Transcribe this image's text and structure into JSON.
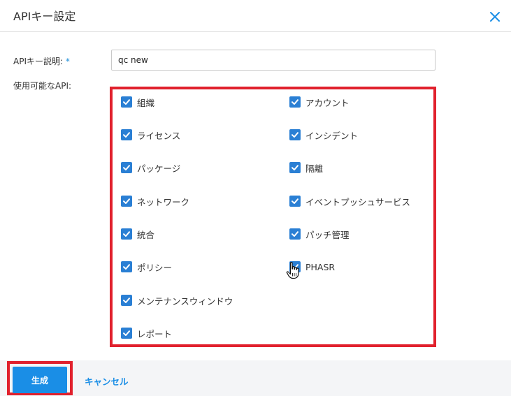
{
  "dialog": {
    "title": "APIキー設定"
  },
  "form": {
    "description_label": "APIキー説明:",
    "required_mark": "*",
    "description_value": "qc new",
    "apis_label": "使用可能なAPI:"
  },
  "apis": {
    "left": [
      {
        "label": "組織",
        "checked": true
      },
      {
        "label": "ライセンス",
        "checked": true
      },
      {
        "label": "パッケージ",
        "checked": true
      },
      {
        "label": "ネットワーク",
        "checked": true
      },
      {
        "label": "統合",
        "checked": true
      },
      {
        "label": "ポリシー",
        "checked": true
      },
      {
        "label": "メンテナンスウィンドウ",
        "checked": true
      },
      {
        "label": "レポート",
        "checked": true
      }
    ],
    "right": [
      {
        "label": "アカウント",
        "checked": true
      },
      {
        "label": "インシデント",
        "checked": true
      },
      {
        "label": "隔離",
        "checked": true
      },
      {
        "label": "イベントプッシュサービス",
        "checked": true
      },
      {
        "label": "パッチ管理",
        "checked": true
      },
      {
        "label": "PHASR",
        "checked": true
      }
    ]
  },
  "footer": {
    "generate_label": "生成",
    "cancel_label": "キャンセル"
  },
  "colors": {
    "accent": "#1a8ee6",
    "checkbox": "#2a7fd4",
    "highlight": "#e1212d"
  },
  "icons": {
    "close": "close-icon",
    "check": "check-icon",
    "cursor": "hand-pointer-icon"
  }
}
